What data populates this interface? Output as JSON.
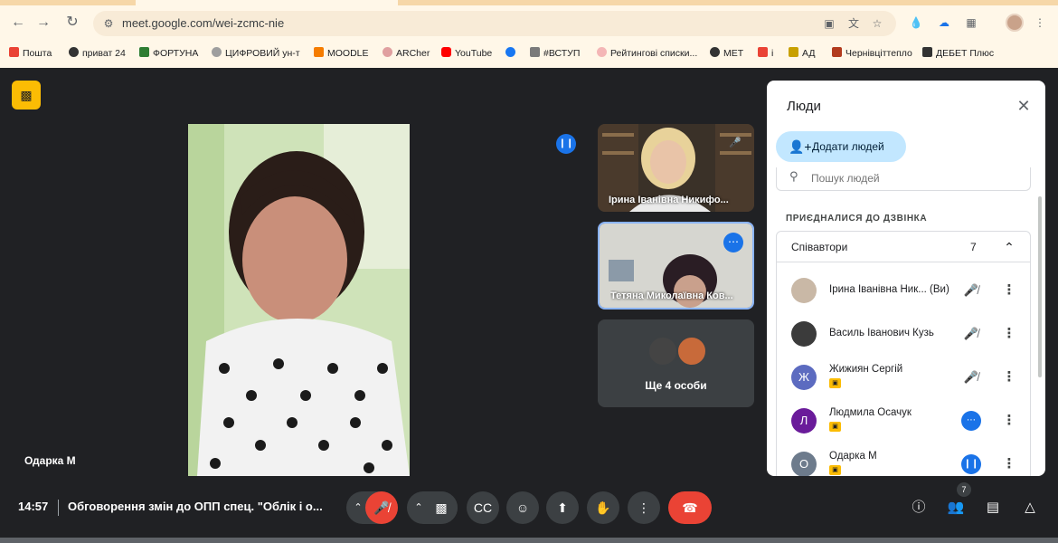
{
  "browser": {
    "url": "meet.google.com/wei-zcmc-nie",
    "bookmarks": [
      {
        "label": "Пошта",
        "color": "#ea4335"
      },
      {
        "label": "приват 24",
        "color": "#333333"
      },
      {
        "label": "ФОРТУНА",
        "color": "#2e7d32"
      },
      {
        "label": "ЦИФРОВИЙ ун-т",
        "color": "#9e9e9e"
      },
      {
        "label": "MOODLE",
        "color": "#f57c00"
      },
      {
        "label": "ARCher",
        "color": "#e0a0a0"
      },
      {
        "label": "YouTube",
        "color": "#ff0000"
      },
      {
        "label": "",
        "color": "#1877f2"
      },
      {
        "label": "#ВСТУП",
        "color": "#7a7a7a"
      },
      {
        "label": "Рейтингові списки...",
        "color": "#f4b6b6"
      },
      {
        "label": "МЕТ",
        "color": "#333333"
      },
      {
        "label": "і",
        "color": "#ea4335"
      },
      {
        "label": "АД",
        "color": "#c8a000"
      },
      {
        "label": "Чернівціттепло",
        "color": "#b23b1e"
      },
      {
        "label": "ДЕБЕТ Плюс",
        "color": "#333333"
      }
    ]
  },
  "stage": {
    "main_participant": "Одарка М",
    "tiles": [
      {
        "name": "Ірина Іванівна Никифо..."
      },
      {
        "name": "Тетяна Миколаївна Ков..."
      }
    ],
    "others_label": "Ще 4 особи"
  },
  "panel": {
    "title": "Люди",
    "add_people": "Додати людей",
    "search_placeholder": "Пошук людей",
    "section": "ПРИЄДНАЛИСЯ ДО ДЗВІНКА",
    "group_label": "Співавтори",
    "group_count": "7",
    "participants": [
      {
        "name": "Ірина Іванівна Ник...",
        "suffix": "(Ви)",
        "initial": "",
        "avatar_color": "#c9b8a6",
        "status": "muted",
        "hand": false
      },
      {
        "name": "Василь Іванович Кузь",
        "suffix": "",
        "initial": "",
        "avatar_color": "#3b3b3b",
        "status": "muted",
        "hand": false
      },
      {
        "name": "Жижиян Сергій",
        "suffix": "",
        "initial": "Ж",
        "avatar_color": "#5c6bc0",
        "status": "muted",
        "hand": true
      },
      {
        "name": "Людмила Осачук",
        "suffix": "",
        "initial": "Л",
        "avatar_color": "#6a1b9a",
        "status": "more",
        "hand": true
      },
      {
        "name": "Одарка М",
        "suffix": "",
        "initial": "О",
        "avatar_color": "#6d7b8c",
        "status": "speaking",
        "hand": true
      }
    ]
  },
  "bottom": {
    "time": "14:57",
    "meeting_title": "Обговорення змін до ОПП спец. \"Облік і о...",
    "people_count": "7"
  },
  "colors": {
    "accent_blue": "#1a73e8",
    "hangup_red": "#ea4335",
    "hand_yellow": "#fbbc04"
  }
}
